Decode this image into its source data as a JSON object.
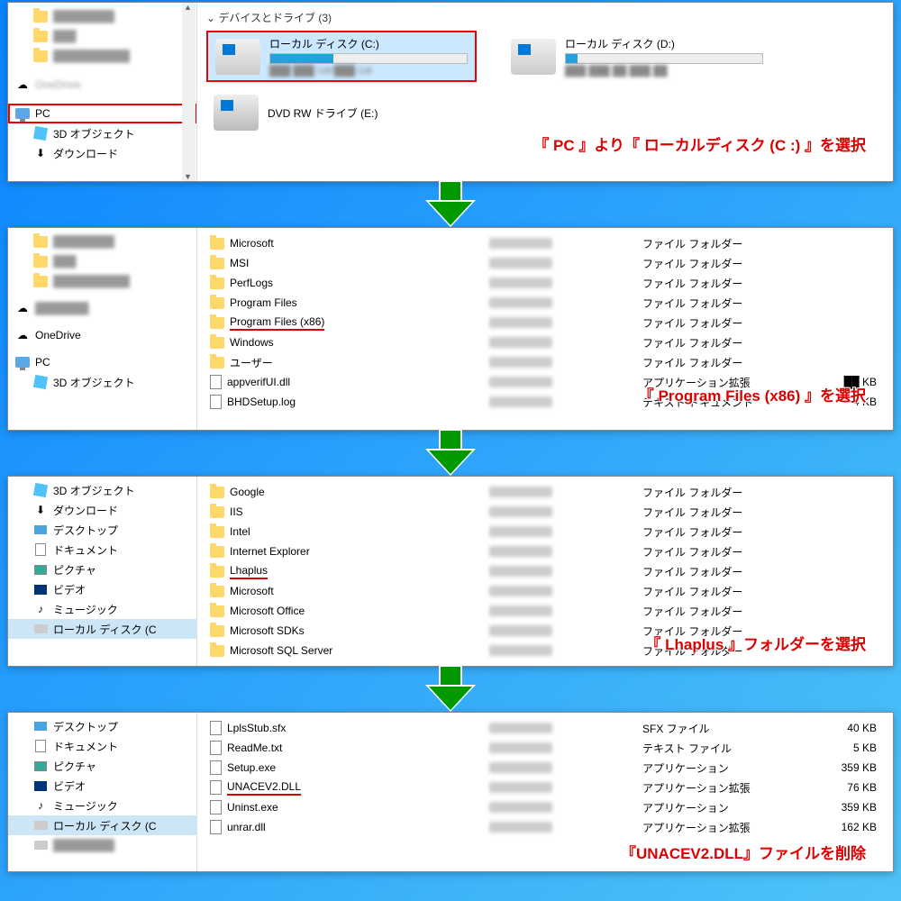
{
  "panel1": {
    "sidebar": {
      "blur_items": [
        "████████",
        "███",
        "██████████"
      ],
      "onedrive_blur": "OneDrive",
      "pc": "PC",
      "objects3d": "3D オブジェクト",
      "downloads": "ダウンロード"
    },
    "section_header": "デバイスとドライブ (3)",
    "drive_c": {
      "label": "ローカル ディスク (C:)",
      "progress": 32,
      "sub": "███ ███ GB/███ GB"
    },
    "drive_d": {
      "label": "ローカル ディスク (D:)",
      "progress": 6,
      "sub": "███ ███ ██ ███ ██"
    },
    "dvd": {
      "label": "DVD RW ドライブ (E:)"
    },
    "annotation": "『 PC 』より『 ローカルディスク (C :) 』を選択"
  },
  "panel2": {
    "sidebar": {
      "blur_items": [
        "████████",
        "███",
        "██████████"
      ],
      "onedrive_blur": "███████",
      "onedrive": "OneDrive",
      "pc": "PC",
      "objects3d": "3D オブジェクト",
      "setup_blur": "BHDSetup.log"
    },
    "folders": [
      {
        "name": "Microsoft",
        "type": "ファイル フォルダー"
      },
      {
        "name": "MSI",
        "type": "ファイル フォルダー"
      },
      {
        "name": "PerfLogs",
        "type": "ファイル フォルダー"
      },
      {
        "name": "Program Files",
        "type": "ファイル フォルダー"
      },
      {
        "name": "Program Files (x86)",
        "type": "ファイル フォルダー",
        "hl": true
      },
      {
        "name": "Windows",
        "type": "ファイル フォルダー"
      },
      {
        "name": "ユーザー",
        "type": "ファイル フォルダー"
      }
    ],
    "files": [
      {
        "name": "appverifUI.dll",
        "type": "アプリケーション拡張",
        "size": "██ KB"
      },
      {
        "name": "BHDSetup.log",
        "type": "テキスト ドキュメント",
        "size": "4 KB"
      }
    ],
    "annotation": "『 Program Files (x86) 』を選択"
  },
  "panel3": {
    "sidebar": {
      "objects3d": "3D オブジェクト",
      "downloads": "ダウンロード",
      "desktop": "デスクトップ",
      "documents": "ドキュメント",
      "pictures": "ピクチャ",
      "videos": "ビデオ",
      "music": "ミュージック",
      "local_c": "ローカル ディスク (C"
    },
    "folders": [
      {
        "name": "Google",
        "type": "ファイル フォルダー"
      },
      {
        "name": "IIS",
        "type": "ファイル フォルダー"
      },
      {
        "name": "Intel",
        "type": "ファイル フォルダー"
      },
      {
        "name": "Internet Explorer",
        "type": "ファイル フォルダー"
      },
      {
        "name": "Lhaplus",
        "type": "ファイル フォルダー",
        "hl": true
      },
      {
        "name": "Microsoft",
        "type": "ファイル フォルダー"
      },
      {
        "name": "Microsoft Office",
        "type": "ファイル フォルダー"
      },
      {
        "name": "Microsoft SDKs",
        "type": "ファイル フォルダー"
      },
      {
        "name": "Microsoft SQL Server",
        "type": "ファイル フォルダー"
      }
    ],
    "annotation": "『 Lhaplus 』フォルダーを選択"
  },
  "panel4": {
    "sidebar": {
      "desktop": "デスクトップ",
      "documents": "ドキュメント",
      "pictures": "ピクチャ",
      "videos": "ビデオ",
      "music": "ミュージック",
      "local_c": "ローカル ディスク (C",
      "blur_bottom": "████████"
    },
    "files": [
      {
        "name": "LplsStub.sfx",
        "type": "SFX ファイル",
        "size": "40 KB"
      },
      {
        "name": "ReadMe.txt",
        "type": "テキスト ファイル",
        "size": "5 KB"
      },
      {
        "name": "Setup.exe",
        "type": "アプリケーション",
        "size": "359 KB"
      },
      {
        "name": "UNACEV2.DLL",
        "type": "アプリケーション拡張",
        "size": "76 KB",
        "hl": true
      },
      {
        "name": "Uninst.exe",
        "type": "アプリケーション",
        "size": "359 KB"
      },
      {
        "name": "unrar.dll",
        "type": "アプリケーション拡張",
        "size": "162 KB"
      }
    ],
    "annotation": "『UNACEV2.DLL』ファイルを削除"
  }
}
